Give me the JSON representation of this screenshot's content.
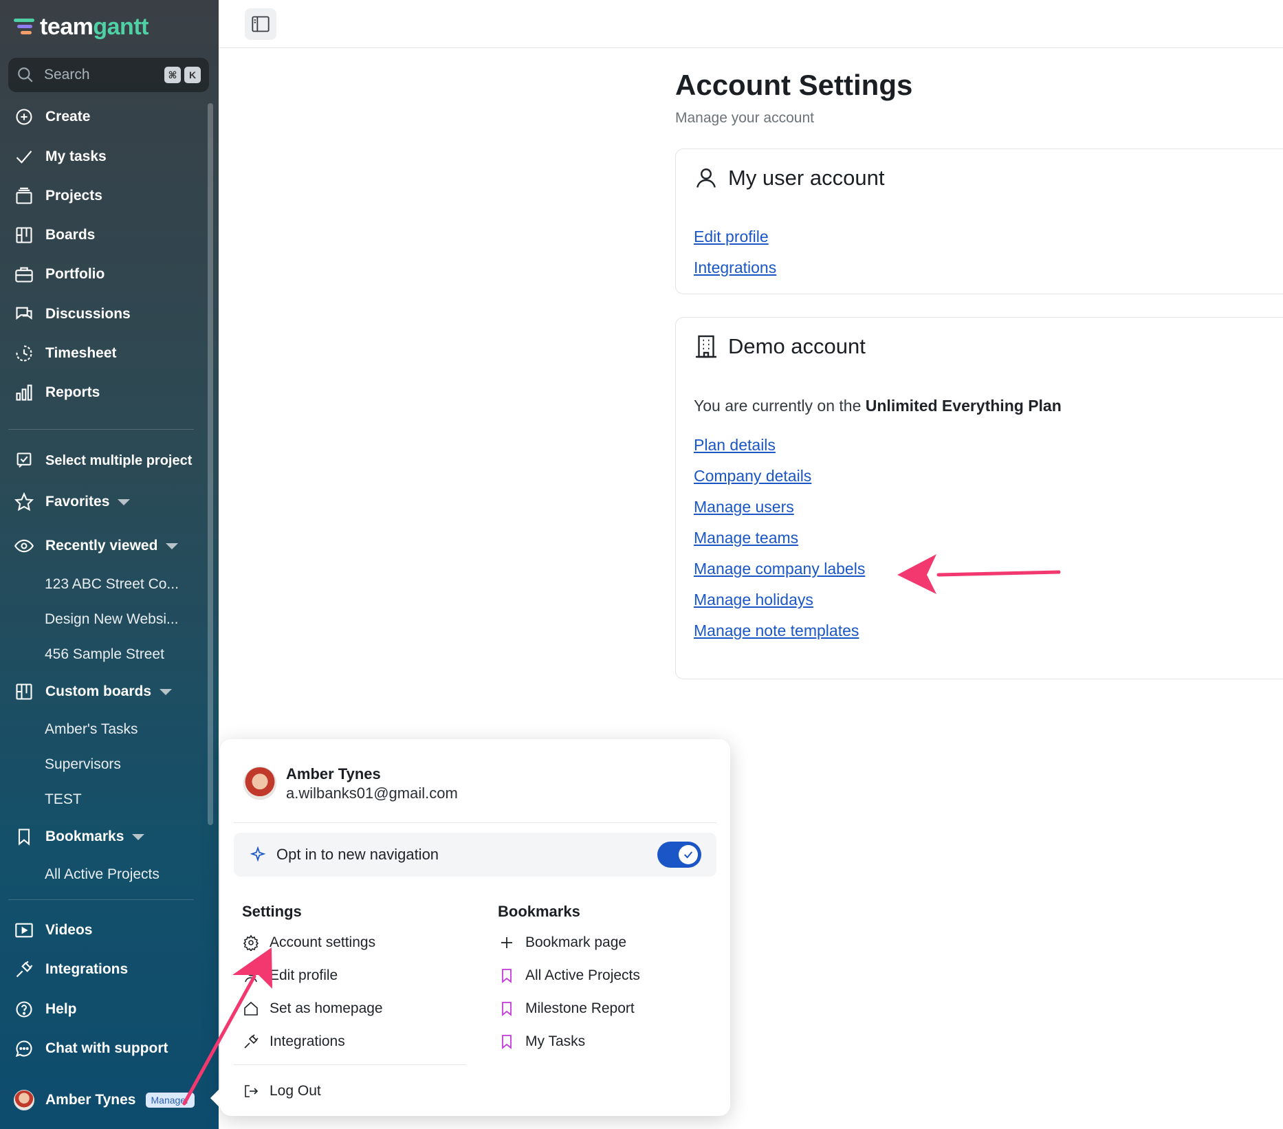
{
  "app": {
    "logo_part1": "team",
    "logo_part2": "gantt"
  },
  "search": {
    "placeholder": "Search",
    "kbd1": "⌘",
    "kbd2": "K"
  },
  "sidebar": {
    "main_items": [
      {
        "label": "Create",
        "icon": "plus-circle-icon"
      },
      {
        "label": "My tasks",
        "icon": "check-icon"
      },
      {
        "label": "Projects",
        "icon": "stack-icon"
      },
      {
        "label": "Boards",
        "icon": "board-icon"
      },
      {
        "label": "Portfolio",
        "icon": "briefcase-icon"
      },
      {
        "label": "Discussions",
        "icon": "chat-bubbles-icon"
      },
      {
        "label": "Timesheet",
        "icon": "clock-icon"
      },
      {
        "label": "Reports",
        "icon": "bar-chart-icon"
      }
    ],
    "select_multiple": "Select multiple project",
    "favorites": "Favorites",
    "recently_viewed": "Recently viewed",
    "recent_items": [
      "123 ABC Street Co...",
      "Design New Websi...",
      "456 Sample Street"
    ],
    "custom_boards": "Custom boards",
    "custom_board_items": [
      "Amber's Tasks",
      "Supervisors",
      "TEST"
    ],
    "bookmarks": "Bookmarks",
    "bookmark_items": [
      "All Active Projects"
    ],
    "bottom_items": [
      {
        "label": "Videos",
        "icon": "video-icon"
      },
      {
        "label": "Integrations",
        "icon": "plug-icon"
      },
      {
        "label": "Help",
        "icon": "help-icon"
      },
      {
        "label": "Chat with support",
        "icon": "chat-icon"
      }
    ],
    "user_name": "Amber Tynes",
    "user_role": "Manager"
  },
  "main": {
    "title": "Account Settings",
    "subtitle": "Manage your account",
    "user_card": {
      "title": "My user account",
      "links": [
        "Edit profile",
        "Integrations"
      ]
    },
    "demo_card": {
      "title": "Demo account",
      "plan_prefix": "You are currently on the ",
      "plan_name": "Unlimited Everything Plan",
      "links": [
        "Plan details",
        "Company details",
        "Manage users",
        "Manage teams",
        "Manage company labels",
        "Manage holidays",
        "Manage note templates"
      ]
    }
  },
  "popup": {
    "name": "Amber Tynes",
    "email": "a.wilbanks01@gmail.com",
    "optin_label": "Opt in to new navigation",
    "optin_enabled": true,
    "settings_heading": "Settings",
    "settings_items": [
      "Account settings",
      "Edit profile",
      "Set as homepage",
      "Integrations"
    ],
    "bookmarks_heading": "Bookmarks",
    "bookmark_items": [
      "Bookmark page",
      "All Active Projects",
      "Milestone Report",
      "My Tasks"
    ],
    "logout": "Log Out"
  },
  "colors": {
    "accent": "#1a56c6",
    "annotation_arrow": "#f2386f",
    "bookmark_icon": "#c23ad8"
  }
}
